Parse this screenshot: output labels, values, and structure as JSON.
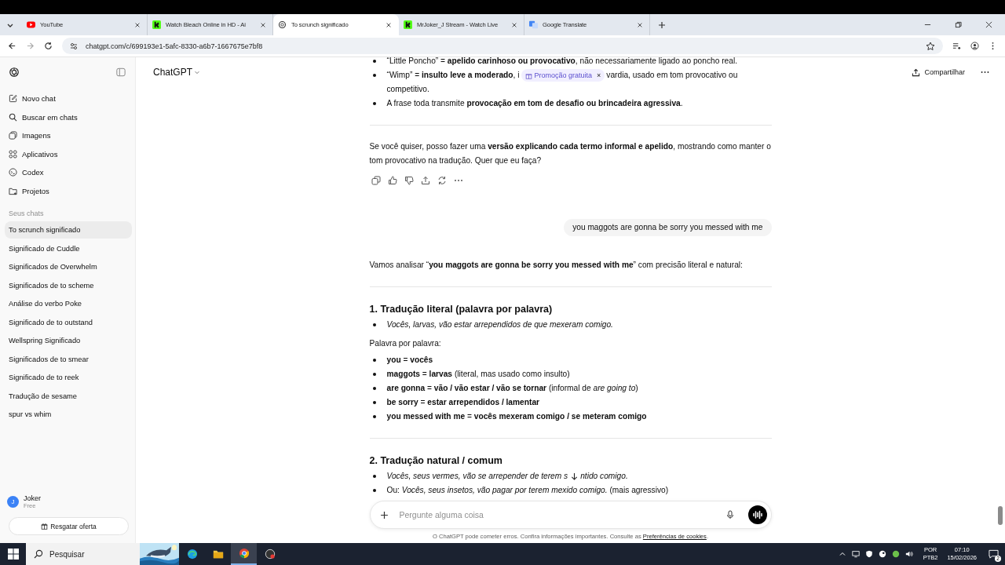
{
  "browser": {
    "tabs": [
      {
        "title": "YouTube",
        "kind": "youtube",
        "selected": false
      },
      {
        "title": "Watch Bleach Online in HD - Ai",
        "kind": "kick",
        "selected": false
      },
      {
        "title": "To scrunch significado",
        "kind": "chatgpt",
        "selected": true
      },
      {
        "title": "MrJoker_J Stream - Watch Live",
        "kind": "kick",
        "selected": false
      },
      {
        "title": "Google Translate",
        "kind": "translate",
        "selected": false
      }
    ],
    "url": "chatgpt.com/c/699193e1-5afc-8330-a6b7-1667675e7bf8"
  },
  "sidebar": {
    "nav": [
      {
        "label": "Novo chat",
        "kind": "new"
      },
      {
        "label": "Buscar em chats",
        "kind": "search"
      },
      {
        "label": "Imagens",
        "kind": "images"
      },
      {
        "label": "Aplicativos",
        "kind": "apps"
      },
      {
        "label": "Codex",
        "kind": "codex"
      },
      {
        "label": "Projetos",
        "kind": "projects"
      }
    ],
    "section_title": "Seus chats",
    "chats": [
      {
        "label": "To scrunch significado",
        "selected": true
      },
      {
        "label": "Significado de Cuddle",
        "selected": false
      },
      {
        "label": "Significados de Overwhelm",
        "selected": false
      },
      {
        "label": "Significados de to scheme",
        "selected": false
      },
      {
        "label": "Análise do verbo Poke",
        "selected": false
      },
      {
        "label": "Significado de to outstand",
        "selected": false
      },
      {
        "label": "Wellspring Significado",
        "selected": false
      },
      {
        "label": "Significados de to smear",
        "selected": false
      },
      {
        "label": "Significado de to reek",
        "selected": false
      },
      {
        "label": "Tradução de sesame",
        "selected": false
      },
      {
        "label": "spur vs whim",
        "selected": false
      }
    ],
    "user": {
      "initial": "J",
      "name": "Joker",
      "plan": "Free"
    },
    "offer_button": "Resgatar oferta"
  },
  "header": {
    "model": "ChatGPT",
    "share": "Compartilhar"
  },
  "conversation": [
    {
      "kind": "bullets",
      "items": [
        {
          "text": "“Little Poncho” = **apelido carinhoso ou provocativo**, não necessariamente ligado ao poncho real."
        },
        {
          "text": "“Wimp” = **insulto leve a moderado**, i",
          "overlay": {
            "kind": "promo",
            "label": "Promoção gratuita",
            "close": "×"
          },
          "after": "vardia, usado em tom provocativo ou competitivo."
        },
        {
          "text": "A frase toda transmite **provocação em tom de desafio ou brincadeira agressiva**."
        }
      ]
    },
    {
      "kind": "rule"
    },
    {
      "kind": "paragraph",
      "text": "Se você quiser, posso fazer uma **versão explicando cada termo informal e apelido**, mostrando como manter o tom provocativo na tradução. Quer que eu faça?"
    },
    {
      "kind": "actions"
    },
    {
      "kind": "user",
      "text": "you maggots are gonna be sorry you messed with me"
    },
    {
      "kind": "paragraph",
      "text": "Vamos analisar “**you maggots are gonna be sorry you messed with me**” com precisão literal e natural:"
    },
    {
      "kind": "rule"
    },
    {
      "kind": "heading",
      "text": "1. Tradução literal (palavra por palavra)"
    },
    {
      "kind": "bullets",
      "items": [
        {
          "text": "Vocês, larvas, vão estar arrependidos de que mexeram comigo.",
          "emphasis": true
        }
      ]
    },
    {
      "kind": "paragraph",
      "text": "Palavra por palavra:"
    },
    {
      "kind": "bullets",
      "items": [
        {
          "text": "**you** = **vocês**"
        },
        {
          "text": "**maggots** = **larvas** (literal, mas usado como insulto)"
        },
        {
          "text": "**are gonna** = **vão / vão estar / vão se tornar** (informal de *are going to*)"
        },
        {
          "text": "**be sorry** = **estar arrependidos / lamentar**"
        },
        {
          "text": "**you messed with me** = **vocês mexeram comigo / se meteram comigo**"
        }
      ]
    },
    {
      "kind": "rule"
    },
    {
      "kind": "heading",
      "text": "2. Tradução natural / comum"
    },
    {
      "kind": "bullets",
      "items": [
        {
          "text": "Vocês, seus vermes, vão se arrepender de terem s",
          "emphasis": true,
          "overlay": {
            "kind": "scroll-down"
          },
          "after": "ntido comigo."
        },
        {
          "text": "Ou: *Vocês, seus insetos, vão pagar por terem mexido comigo.* (mais agressivo)"
        }
      ]
    }
  ],
  "composer": {
    "placeholder": "Pergunte alguma coisa"
  },
  "disclaimer": {
    "text": "O ChatGPT pode cometer erros. Confira informações importantes. Consulte as",
    "link": "Preferências de cookies",
    "end": "."
  },
  "taskbar": {
    "search_placeholder": "Pesquisar",
    "apps": [
      {
        "kind": "edge",
        "selected": false
      },
      {
        "kind": "explorer",
        "selected": false
      },
      {
        "kind": "chrome",
        "selected": true
      },
      {
        "kind": "recorder",
        "selected": false
      }
    ],
    "language": "POR",
    "layout": "PTB2",
    "time": "07:10",
    "date": "15/02/2026",
    "notifications": "2"
  }
}
